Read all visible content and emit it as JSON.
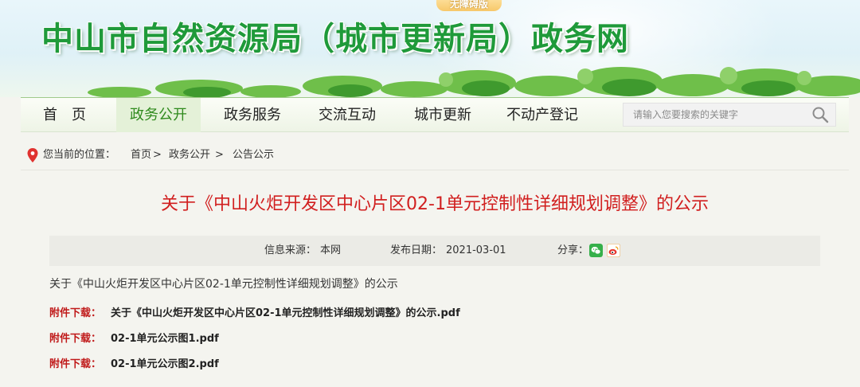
{
  "banner": {
    "badge": "无障碍版",
    "site_title": "中山市自然资源局（城市更新局）政务网"
  },
  "nav": {
    "items": [
      {
        "label": "首　页"
      },
      {
        "label": "政务公开"
      },
      {
        "label": "政务服务"
      },
      {
        "label": "交流互动"
      },
      {
        "label": "城市更新"
      },
      {
        "label": "不动产登记"
      }
    ],
    "active_index": 1,
    "search": {
      "placeholder": "请输入您要搜索的关键字"
    }
  },
  "breadcrumb": {
    "prefix": "您当前的位置：",
    "items": [
      "首页",
      "政务公开",
      "公告公示"
    ],
    "separators": [
      " >",
      " > "
    ]
  },
  "article": {
    "title": "关于《中山火炬开发区中心片区02-1单元控制性详细规划调整》的公示",
    "source_label": "信息来源：",
    "source_value": "本网",
    "date_label": "发布日期：",
    "date_value": "2021-03-01",
    "share_label": "分享：",
    "intro": "关于《中山火炬开发区中心片区02-1单元控制性详细规划调整》的公示",
    "attachments": [
      {
        "label": "附件下载：",
        "file": "关于《中山火炬开发区中心片区02-1单元控制性详细规划调整》的公示.pdf"
      },
      {
        "label": "附件下载：",
        "file": "02-1单元公示图1.pdf"
      },
      {
        "label": "附件下载：",
        "file": "02-1单元公示图2.pdf"
      }
    ]
  },
  "colors": {
    "title_green": "#1f9a3a",
    "article_title_red": "#d11f1f",
    "attach_label_red": "#c01a1a",
    "nav_active_green": "#2f8a1d"
  },
  "icons": [
    "location-pin-icon",
    "search-icon",
    "wechat-icon",
    "weibo-icon"
  ]
}
